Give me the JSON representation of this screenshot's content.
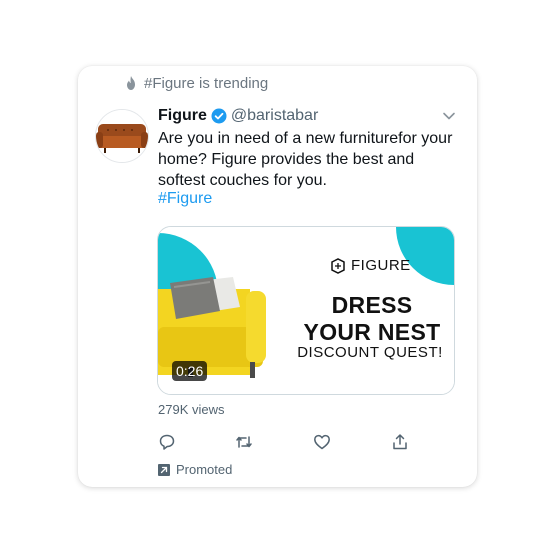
{
  "trend": {
    "icon": "flame-icon",
    "text": "#Figure is trending"
  },
  "tweet": {
    "name": "Figure",
    "handle": "@baristabar",
    "verified_icon": "verified-badge-icon",
    "text": "Are you in need of a new furniturefor your home? Figure provides the best and softest couches for you.",
    "hashtag": "#Figure"
  },
  "ad": {
    "brand": "FIGURE",
    "headline_1": "DRESS",
    "headline_2": "YOUR NEST",
    "subline": "DISCOUNT QUEST!",
    "duration": "0:26"
  },
  "views": "279K views",
  "actions": [
    {
      "icon": "reply-icon"
    },
    {
      "icon": "retweet-icon"
    },
    {
      "icon": "like-icon"
    },
    {
      "icon": "share-icon"
    }
  ],
  "promoted": {
    "icon": "promoted-arrow-icon",
    "label": "Promoted"
  },
  "colors": {
    "accent": "#1d9bf0",
    "ad_teal": "#19c3d3",
    "sofa_yellow": "#f3d521",
    "muted_text": "#536471"
  }
}
